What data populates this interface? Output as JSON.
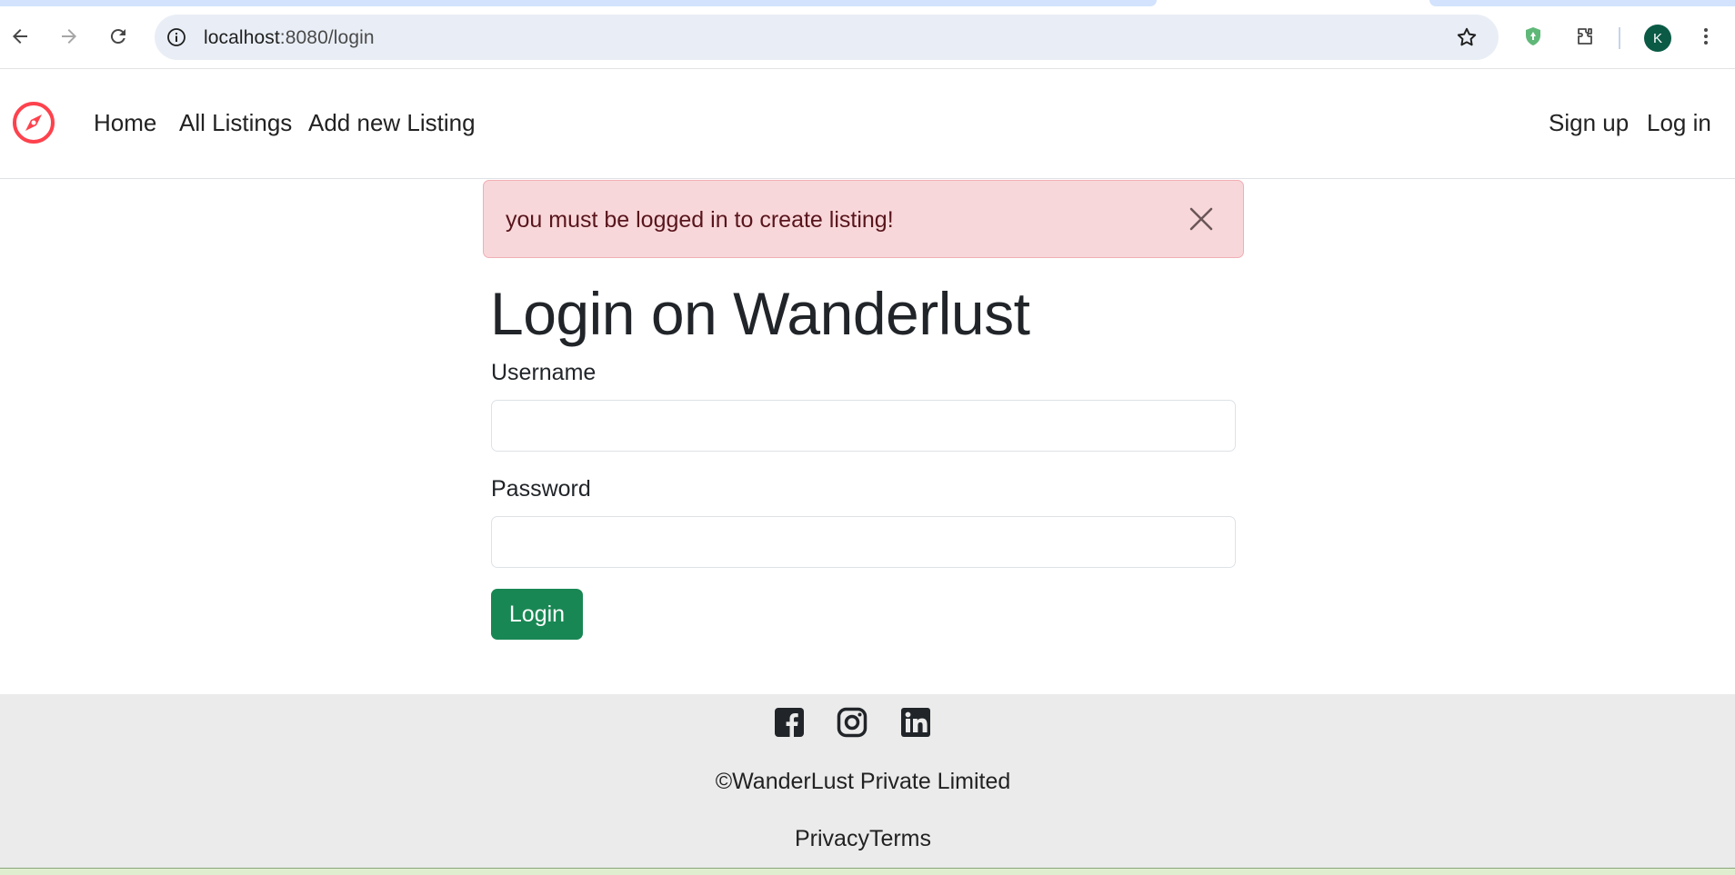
{
  "browser": {
    "url_host": "localhost",
    "url_rest": ":8080/login",
    "profile_initial": "K",
    "icons": [
      "back-arrow-icon",
      "forward-arrow-icon",
      "reload-icon",
      "info-icon",
      "bookmark-star-icon",
      "shield-extension-icon",
      "extensions-puzzle-icon",
      "more-vert-icon"
    ],
    "colors": {
      "omnibox_bg": "#e9eef6",
      "avatar_bg": "#0b5a46"
    }
  },
  "navbar": {
    "brand_icon": "compass-icon",
    "brand_color": "#fe424d",
    "links": {
      "home": "Home",
      "all_listings": "All Listings",
      "add_listing": "Add new Listing",
      "signup": "Sign up",
      "login": "Log in"
    }
  },
  "alert": {
    "message": "you must be logged in to create listing!",
    "close_icon": "close-icon",
    "bg": "#f8d7da"
  },
  "form": {
    "title": "Login on Wanderlust",
    "username_label": "Username",
    "username_value": "",
    "password_label": "Password",
    "password_value": "",
    "submit_label": "Login",
    "submit_color": "#198754"
  },
  "footer": {
    "social_icons": [
      "facebook-icon",
      "instagram-icon",
      "linkedin-icon"
    ],
    "copyright": "©WanderLust Private Limited",
    "links": {
      "privacy": "Privacy",
      "terms": "Terms"
    },
    "bg": "#ebebeb"
  }
}
